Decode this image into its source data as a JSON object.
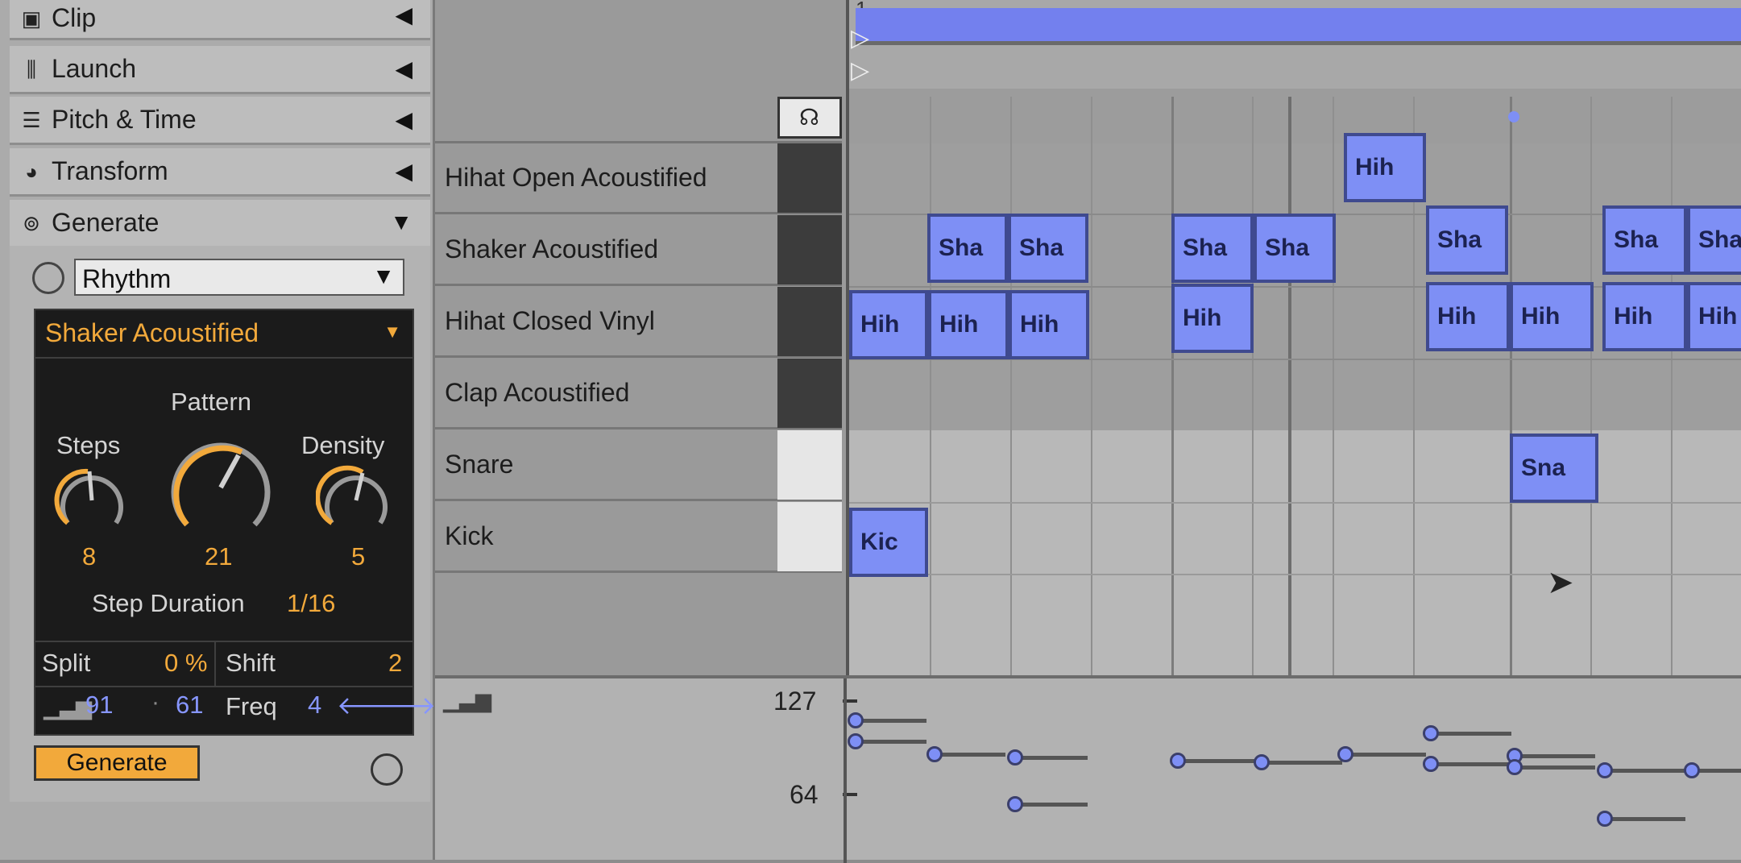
{
  "sections": [
    {
      "label": "Clip",
      "icon": "clip-icon"
    },
    {
      "label": "Launch",
      "icon": "launch-icon"
    },
    {
      "label": "Pitch & Time",
      "icon": "pitch-time-icon"
    },
    {
      "label": "Transform",
      "icon": "transform-icon"
    },
    {
      "label": "Generate",
      "icon": "generate-icon"
    }
  ],
  "generator": {
    "mode": "Rhythm",
    "part": "Shaker Acoustified",
    "pattern_label": "Pattern",
    "steps_label": "Steps",
    "steps_value": "8",
    "pattern_value": "21",
    "density_label": "Density",
    "density_value": "5",
    "step_duration_label": "Step Duration",
    "step_duration_value": "1/16",
    "split_label": "Split",
    "split_value": "0 %",
    "shift_label": "Shift",
    "shift_value": "2",
    "vel_a": "91",
    "vel_sep": "·",
    "vel_b": "61",
    "freq_label": "Freq",
    "freq_value": "4",
    "generate_label": "Generate",
    "accent": "#f2a93b"
  },
  "tracks": [
    {
      "name": "Hihat Open Acoustified"
    },
    {
      "name": "Shaker Acoustified"
    },
    {
      "name": "Hihat Closed Vinyl"
    },
    {
      "name": "Clap Acoustified"
    },
    {
      "name": "Snare"
    },
    {
      "name": "Kick"
    }
  ],
  "ruler": {
    "bar": "1"
  },
  "notes": {
    "hihat_open": "Hih",
    "shaker": "Sha",
    "hihat_closed": "Hih",
    "snare": "Sna",
    "kick": "Kic"
  },
  "velocity": {
    "max": "127",
    "mid": "64"
  },
  "note_color": "#7e8ff5"
}
